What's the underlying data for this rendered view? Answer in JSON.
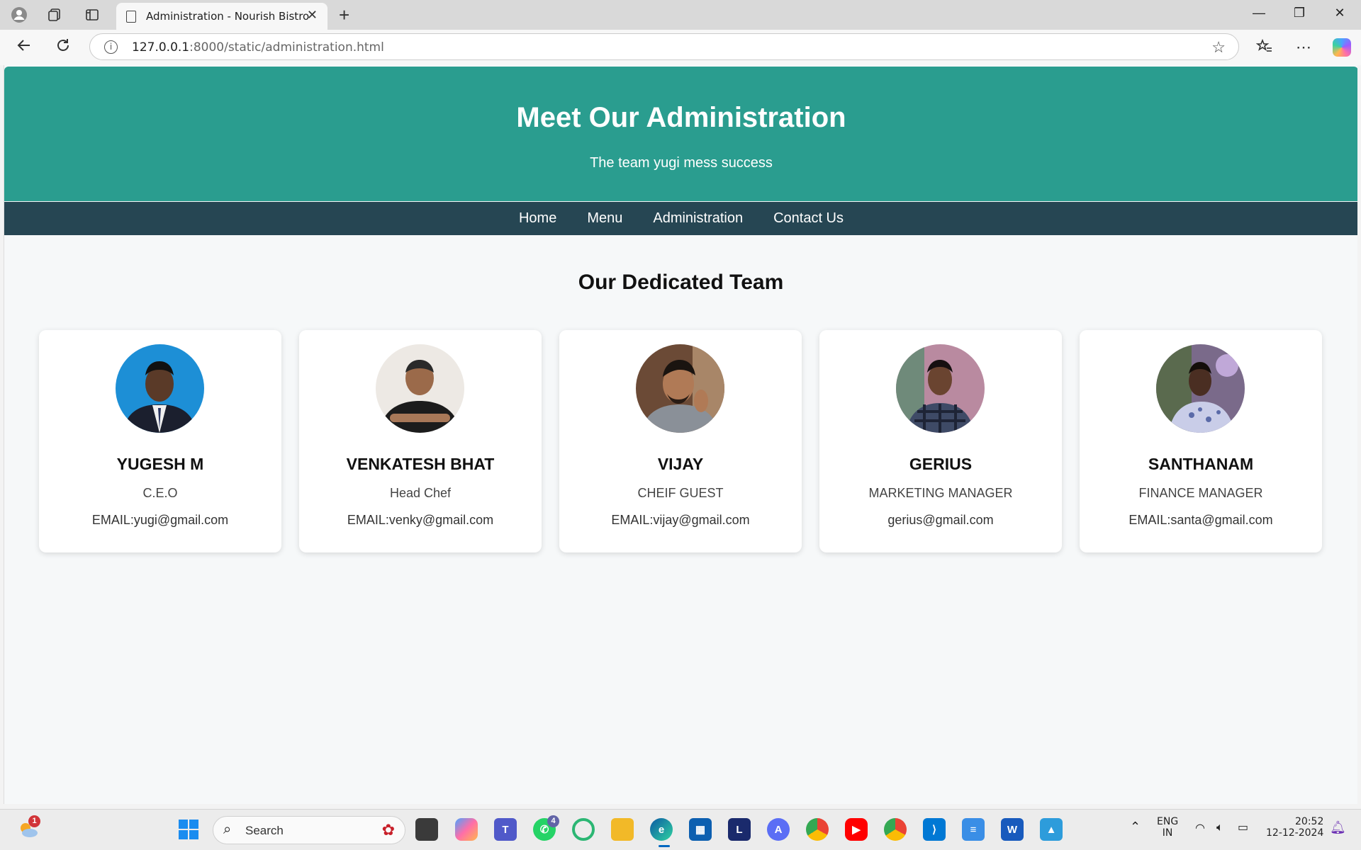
{
  "browser": {
    "tab_title": "Administration - Nourish Bistro",
    "url_host": "127.0.0.1",
    "url_rest": ":8000/static/administration.html"
  },
  "hero": {
    "title": "Meet Our Administration",
    "subtitle": "The team yugi mess success"
  },
  "nav": {
    "items": [
      "Home",
      "Menu",
      "Administration",
      "Contact Us"
    ]
  },
  "team": {
    "title": "Our Dedicated Team",
    "members": [
      {
        "name": "YUGESH M",
        "role": "C.E.O",
        "email": "EMAIL:yugi@gmail.com"
      },
      {
        "name": "VENKATESH BHAT",
        "role": "Head Chef",
        "email": "EMAIL:venky@gmail.com"
      },
      {
        "name": "VIJAY",
        "role": "CHEIF GUEST",
        "email": "EMAIL:vijay@gmail.com"
      },
      {
        "name": "GERIUS",
        "role": "MARKETING MANAGER",
        "email": "gerius@gmail.com"
      },
      {
        "name": "SANTHANAM",
        "role": "FINANCE MANAGER",
        "email": "EMAIL:santa@gmail.com"
      }
    ]
  },
  "taskbar": {
    "search_label": "Search",
    "weather_badge": "1",
    "whatsapp_badge": "4",
    "language_primary": "ENG",
    "language_secondary": "IN",
    "time": "20:52",
    "date": "12-12-2024"
  }
}
